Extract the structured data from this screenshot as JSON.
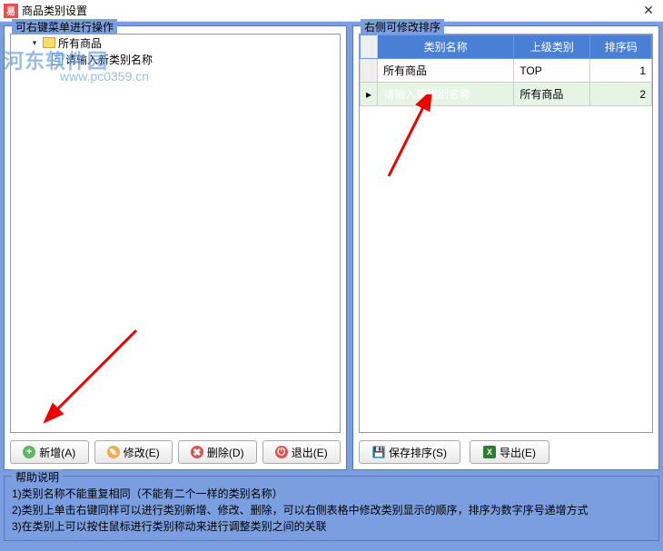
{
  "window": {
    "title": "商品类别设置",
    "icon_text": "易"
  },
  "left_panel": {
    "label": "可右键菜单进行操作",
    "tree": {
      "root": "所有商品",
      "child": "请输入新类别名称"
    }
  },
  "right_panel": {
    "label": "右侧可修改排序",
    "headers": {
      "name": "类别名称",
      "parent": "上级类别",
      "sort": "排序码"
    },
    "rows": [
      {
        "name": "所有商品",
        "parent": "TOP",
        "sort": "1"
      },
      {
        "name": "请输入新类别名称",
        "parent": "所有商品",
        "sort": "2"
      }
    ]
  },
  "buttons": {
    "add": "新增(A)",
    "edit": "修改(E)",
    "del": "删除(D)",
    "exit": "退出(E)",
    "save": "保存排序(S)",
    "export": "导出(E)"
  },
  "help": {
    "label": "帮助说明",
    "line1": "1)类别名称不能重复相同（不能有二个一样的类别名称）",
    "line2": "2)类别上单击右键同样可以进行类别新增、修改、删除，可以右侧表格中修改类别显示的顺序，排序为数字序号递增方式",
    "line3": "3)在类别上可以按住鼠标进行类别称动来进行调整类别之间的关联"
  },
  "watermark": {
    "main": "河东软件园",
    "url": "www.pc0359.cn"
  }
}
